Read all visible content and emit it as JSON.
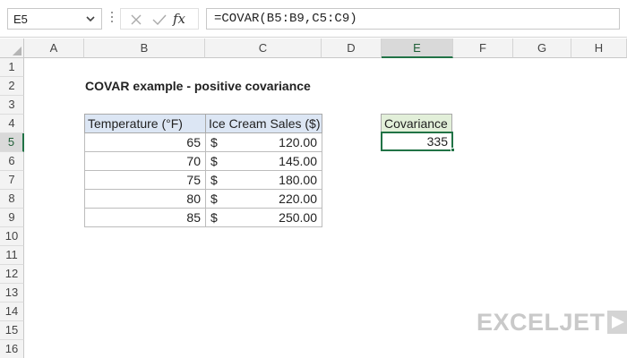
{
  "formula_bar": {
    "name_box": "E5",
    "formula": "=COVAR(B5:B9,C5:C9)",
    "fx_label": "fx"
  },
  "columns": [
    "A",
    "B",
    "C",
    "D",
    "E",
    "F",
    "G",
    "H"
  ],
  "rows": [
    "1",
    "2",
    "3",
    "4",
    "5",
    "6",
    "7",
    "8",
    "9",
    "10",
    "11",
    "12",
    "13",
    "14",
    "15",
    "16"
  ],
  "selected_cell": "E5",
  "sheet": {
    "title": "COVAR example - positive covariance",
    "table": {
      "headers": [
        "Temperature (°F)",
        "Ice Cream Sales ($)"
      ],
      "currency_symbol": "$",
      "rows": [
        {
          "temp": "65",
          "sales": "120.00"
        },
        {
          "temp": "70",
          "sales": "145.00"
        },
        {
          "temp": "75",
          "sales": "180.00"
        },
        {
          "temp": "80",
          "sales": "220.00"
        },
        {
          "temp": "85",
          "sales": "250.00"
        }
      ]
    },
    "result": {
      "header": "Covariance",
      "value": "335"
    }
  },
  "logo": {
    "text": "EXCELJET"
  },
  "colors": {
    "accent": "#217346",
    "table_header_bg": "#dce6f4",
    "result_header_bg": "#e2efd9"
  }
}
